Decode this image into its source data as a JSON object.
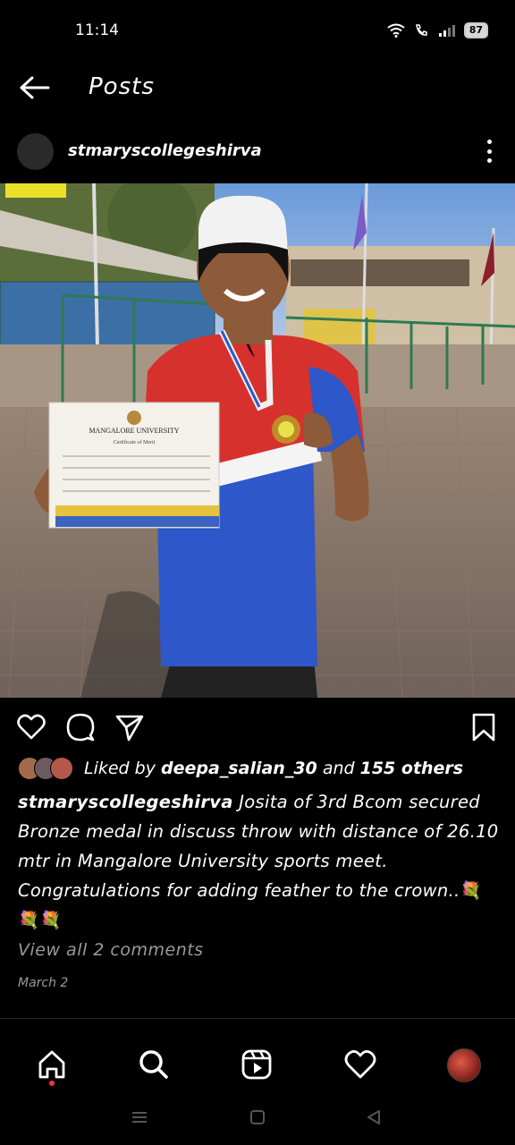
{
  "status_bar": {
    "time": "11:14",
    "battery": "87"
  },
  "header": {
    "title": "Posts"
  },
  "post": {
    "username": "stmaryscollegeshirva",
    "likes": {
      "prefix": "Liked by",
      "user": "deepa_salian_30",
      "joiner": "and",
      "others": "155 others"
    },
    "caption": {
      "user": "stmaryscollegeshirva",
      "text": "Josita of 3rd Bcom secured Bronze medal in discuss throw with distance of 26.10 mtr in Mangalore University sports meet. Congratulations for adding feather to the crown..",
      "emoji_1": "💐",
      "emoji_2": "💐",
      "emoji_3": "💐"
    },
    "view_comments": "View all 2 comments",
    "date": "March 2"
  },
  "photo": {
    "certificate_university": "MANGALORE UNIVERSITY",
    "certificate_title": "Certificate of Merit"
  },
  "colors": {
    "background": "#000000",
    "muted_text": "#9a9a9a",
    "notification_dot": "#ff3040"
  }
}
